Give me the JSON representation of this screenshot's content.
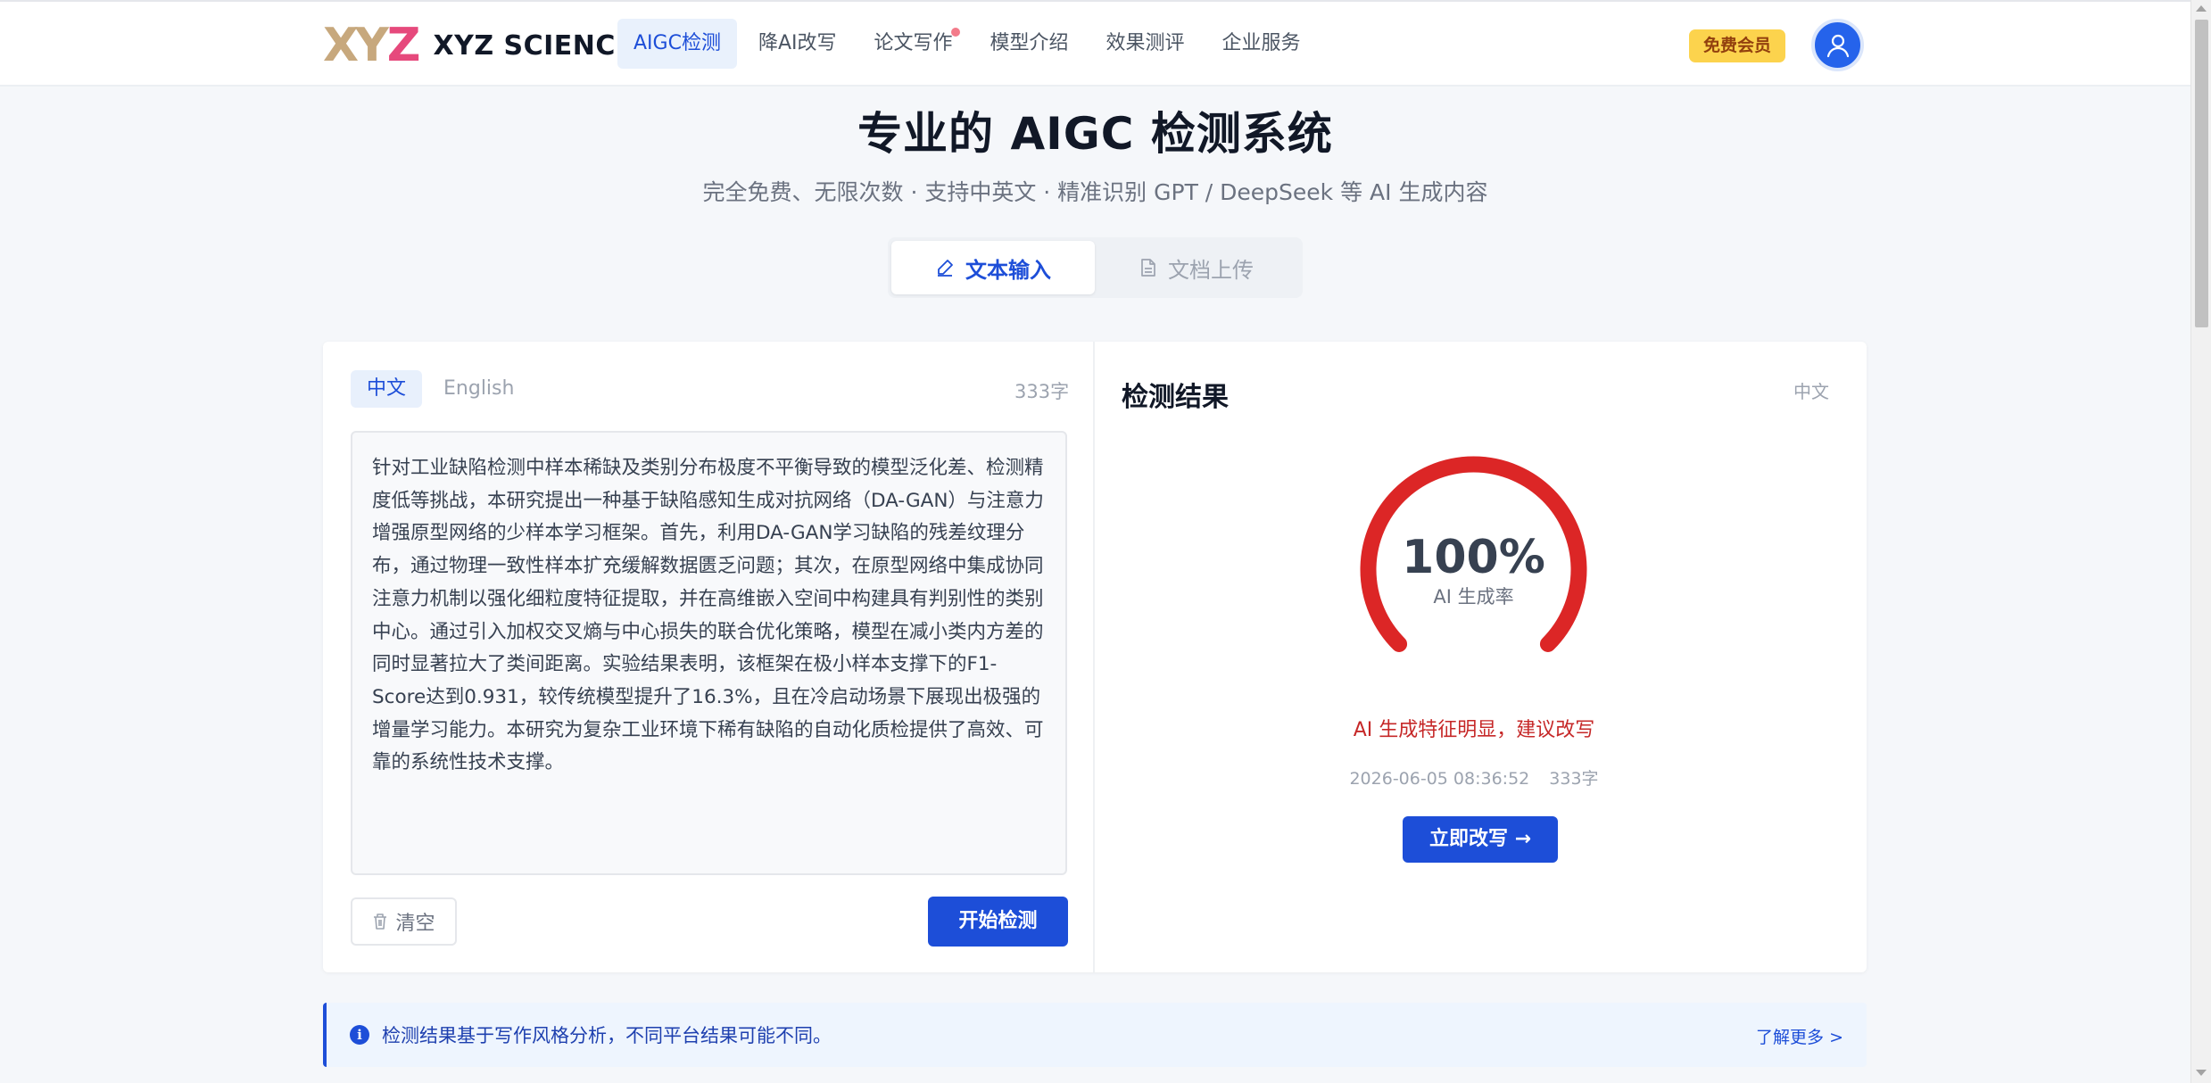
{
  "header": {
    "logo_mark": [
      "X",
      "Y",
      "Z"
    ],
    "logo_text": "XYZ SCIENCE",
    "nav": [
      {
        "label": "AIGC检测",
        "active": true
      },
      {
        "label": "降AI改写",
        "active": false
      },
      {
        "label": "论文写作",
        "active": false,
        "badge_dot": true
      },
      {
        "label": "模型介绍",
        "active": false
      },
      {
        "label": "效果测评",
        "active": false
      },
      {
        "label": "企业服务",
        "active": false
      }
    ],
    "member_button": "免费会员",
    "avatar_icon": "user-icon"
  },
  "hero": {
    "title": "专业的 AIGC 检测系统",
    "subtitle": "完全免费、无限次数 · 支持中英文 · 精准识别 GPT / DeepSeek 等 AI 生成内容",
    "mode_tabs": [
      {
        "label": "文本输入",
        "icon": "pen-icon",
        "active": true
      },
      {
        "label": "文档上传",
        "icon": "document-icon",
        "active": false
      }
    ]
  },
  "input": {
    "lang_tabs": [
      {
        "label": "中文",
        "active": true
      },
      {
        "label": "English",
        "active": false
      }
    ],
    "char_count": "333字",
    "text": "针对工业缺陷检测中样本稀缺及类别分布极度不平衡导致的模型泛化差、检测精度低等挑战，本研究提出一种基于缺陷感知生成对抗网络（DA-GAN）与注意力增强原型网络的少样本学习框架。首先，利用DA-GAN学习缺陷的残差纹理分布，通过物理一致性样本扩充缓解数据匮乏问题；其次，在原型网络中集成协同注意力机制以强化细粒度特征提取，并在高维嵌入空间中构建具有判别性的类别中心。通过引入加权交叉熵与中心损失的联合优化策略，模型在减小类内方差的同时显著拉大了类间距离。实验结果表明，该框架在极小样本支撑下的F1-Score达到0.931，较传统模型提升了16.3%，且在冷启动场景下展现出极强的增量学习能力。本研究为复杂工业环境下稀有缺陷的自动化质检提供了高效、可靠的系统性技术支撑。",
    "clear_button": "清空",
    "clear_icon": "trash-icon",
    "detect_button": "开始检测"
  },
  "result": {
    "title": "检测结果",
    "language": "中文",
    "ai_rate": 100,
    "ai_rate_text": "100%",
    "ai_rate_label": "AI 生成率",
    "gauge_color": "#dc2626",
    "verdict": "AI 生成特征明显，建议改写",
    "timestamp": "2026-06-05 08:36:52",
    "char_count": "333字",
    "rewrite_button": "立即改写 →"
  },
  "notice": {
    "icon": "info-icon",
    "text": "检测结果基于写作风格分析，不同平台结果可能不同。",
    "link": "了解更多 >"
  },
  "colors": {
    "primary": "#1d4ed8",
    "danger": "#dc2626",
    "member": "#fcd34d"
  }
}
